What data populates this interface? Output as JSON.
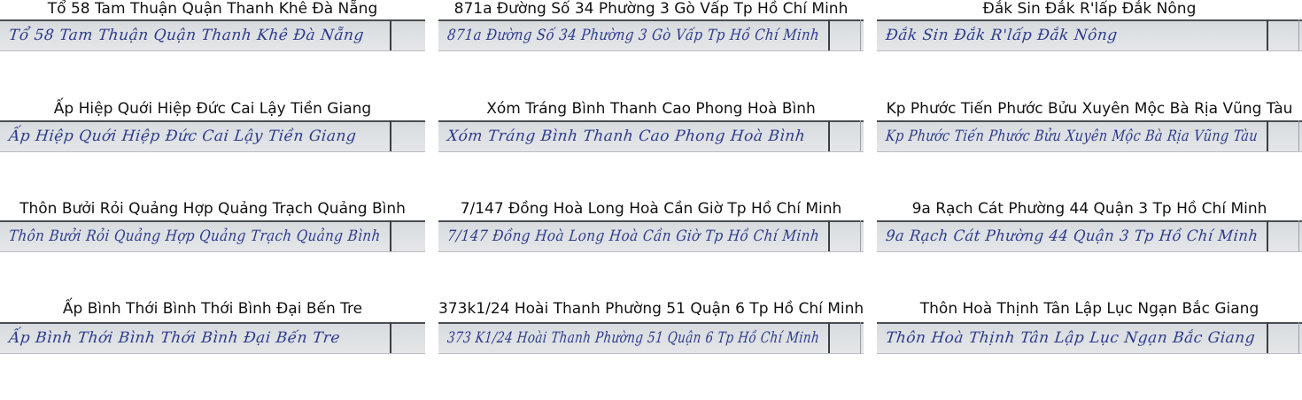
{
  "samples": [
    {
      "caption": "Tổ 58 Tam Thuận Quận Thanh Khê Đà Nẵng",
      "handwriting": "Tổ 58 Tam Thuận Quận Thanh Khê Đà Nẵng"
    },
    {
      "caption": "871a Đường Số 34 Phường 3 Gò Vấp Tp Hồ Chí Minh",
      "handwriting": "871a Đường Số 34 Phường 3 Gò Vấp Tp Hồ Chí Minh"
    },
    {
      "caption": "Đắk Sin Đắk R'lấp Đắk Nông",
      "handwriting": "Đắk Sin Đắk R'lấp Đắk Nông"
    },
    {
      "caption": "Ấp Hiệp Quới Hiệp Đức Cai Lậy Tiền Giang",
      "handwriting": "Ấp Hiệp Quới Hiệp Đức Cai Lậy Tiền Giang"
    },
    {
      "caption": "Xóm Tráng Bình Thanh Cao Phong Hoà Bình",
      "handwriting": "Xóm Tráng Bình Thanh Cao Phong Hoà Bình"
    },
    {
      "caption": "Kp Phước Tiến Phước Bửu Xuyên Mộc Bà Rịa Vũng Tàu",
      "handwriting": "Kp Phước Tiến Phước Bửu Xuyên Mộc Bà Rịa Vũng Tàu"
    },
    {
      "caption": "Thôn Bưởi Rỏi Quảng Hợp Quảng Trạch Quảng Bình",
      "handwriting": "Thôn Bưởi Rỏi Quảng Hợp Quảng Trạch Quảng Bình"
    },
    {
      "caption": "7/147 Đồng Hoà Long Hoà Cần Giờ Tp Hồ Chí Minh",
      "handwriting": "7/147 Đồng Hoà Long Hoà Cần Giờ Tp Hồ Chí Minh"
    },
    {
      "caption": "9a Rạch Cát Phường 44 Quận 3 Tp Hồ Chí Minh",
      "handwriting": "9a Rạch Cát Phường 44 Quận 3 Tp Hồ Chí Minh"
    },
    {
      "caption": "Ấp Bình Thới Bình Thới Bình Đại Bến Tre",
      "handwriting": "Ấp Bình Thới Bình Thới Bình Đại Bến Tre"
    },
    {
      "caption": "373k1/24 Hoài Thanh Phường 51 Quận 6 Tp Hồ Chí Minh",
      "handwriting": "373 K1/24 Hoài Thanh Phường 51 Quận 6 Tp Hồ Chí Minh"
    },
    {
      "caption": "Thôn Hoà Thịnh Tân Lập Lục Ngạn Bắc Giang",
      "handwriting": "Thôn Hoà Thịnh Tân Lập Lục Ngạn Bắc Giang"
    }
  ],
  "colors": {
    "ink": "#2c3a8a",
    "paper": "#dde0e3",
    "caption": "#111111"
  }
}
